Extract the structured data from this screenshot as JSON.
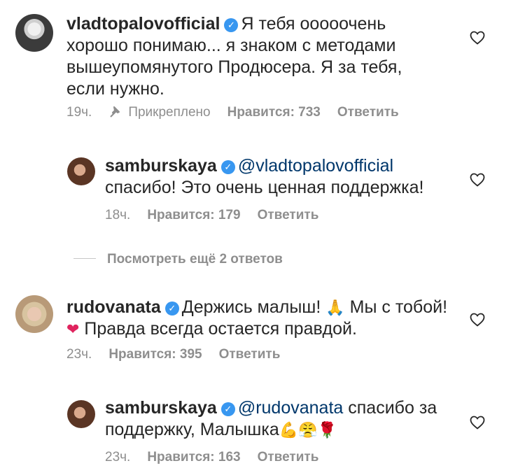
{
  "comments": [
    {
      "username": "vladtopalovofficial",
      "text": "Я тебя ооооочень хорошо понимаю... я знаком с методами вышеупомянутого Продюсера. Я за тебя, если нужно.",
      "time": "19ч.",
      "pinned_label": "Прикреплено",
      "likes": "Нравится: 733",
      "reply_label": "Ответить",
      "avatar": "vlad-avatar"
    },
    {
      "username": "samburskaya",
      "mention": "@vladtopalovofficial",
      "text": "спасибо! Это очень ценная поддержка!",
      "time": "18ч.",
      "likes": "Нравится: 179",
      "reply_label": "Ответить",
      "avatar": "samburskaya-avatar"
    },
    {
      "username": "rudovanata",
      "text_part1": "Держись малыш!",
      "text_part2": "Мы с тобой!",
      "text_part3": "Правда всегда остается правдой.",
      "time": "23ч.",
      "likes": "Нравится: 395",
      "reply_label": "Ответить",
      "avatar": "rudovanata-avatar"
    },
    {
      "username": "samburskaya",
      "mention": "@rudovanata",
      "text": "спасибо за поддержку, Малышка",
      "time": "23ч.",
      "likes": "Нравится: 163",
      "reply_label": "Ответить",
      "avatar": "samburskaya-avatar"
    }
  ],
  "view_more": "Посмотреть ещё 2 ответов",
  "colors": {
    "verified": "#3897f0",
    "meta": "#8e8e8e",
    "mention": "#00376b"
  },
  "icons": [
    "verified-badge-icon",
    "pin-icon",
    "heart-icon",
    "pray-emoji",
    "red-heart-emoji",
    "muscle-emoji",
    "triumph-emoji",
    "rose-emoji"
  ]
}
